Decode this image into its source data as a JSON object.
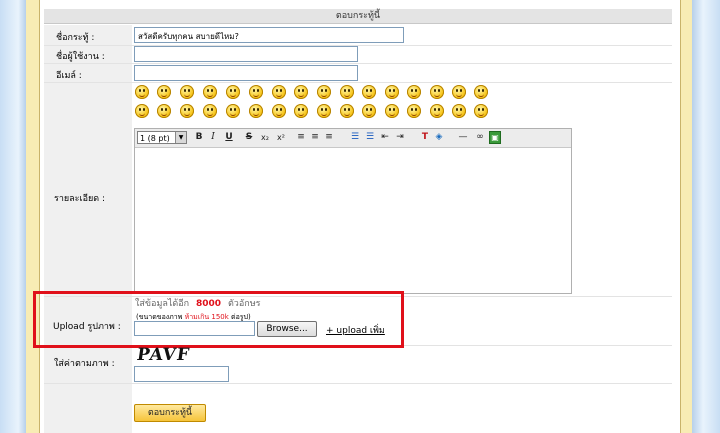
{
  "form": {
    "header": "ตอบกระทู้นี้",
    "title_label": "ชื่อกระทู้ :",
    "title_value": "สวัสดีครับทุกคน สบายดีไหม?",
    "username_label": "ชื่อผู้ใช้งาน :",
    "email_label": "อีเมล์ :",
    "detail_label": "รายละเอียด :",
    "font_size": "1 (8 pt)",
    "char_limit_prefix": "ใส่ข้อมูลได้อีก",
    "char_limit_value": "8000",
    "char_limit_suffix": "ตัวอักษร",
    "upload_label": "Upload รูปภาพ :",
    "upload_note_prefix": "(ขนาดของภาพ",
    "upload_note_limit": "ห้ามเกิน 150k",
    "upload_note_suffix": "ต่อรูป)",
    "browse_label": "Browse...",
    "upload_more": "+ upload เพิ่ม",
    "captcha_text": "PAVF",
    "captcha_label": "ใส่ค่าตามภาพ :",
    "submit_label": "ตอบกระทู้นี้"
  },
  "toolbar": {
    "bold": "B",
    "italic": "I",
    "underline": "U",
    "strike": "S",
    "subscript": "x₂",
    "superscript": "x²"
  },
  "colors": {
    "highlight": "#e0101a",
    "limit_value": "#e0101a",
    "frame": "#f8ecb4"
  }
}
